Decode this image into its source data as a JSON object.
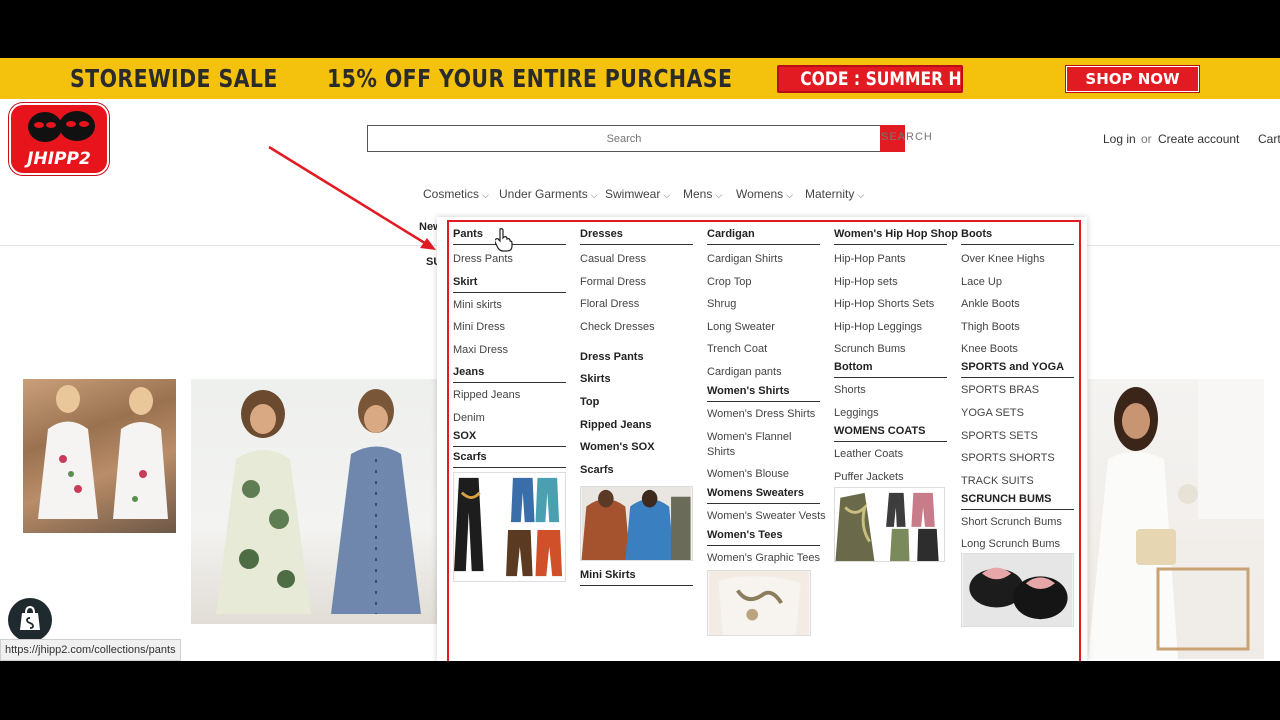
{
  "promo": {
    "sale_text": "STOREWIDE SALE",
    "offer_text": "15% OFF YOUR ENTIRE PURCHASE",
    "code_text": "CODE : SUMMER HEAT",
    "shop_now": "SHOP NOW"
  },
  "brand": {
    "logo_text": "JHIPP2"
  },
  "search": {
    "placeholder": "Search",
    "button_label": "SEARCH"
  },
  "account": {
    "login": "Log in",
    "or": "or",
    "create": "Create account",
    "cart": "Cart"
  },
  "nav": {
    "items": [
      "Cosmetics",
      "Under Garments",
      "Swimwear",
      "Mens",
      "Womens",
      "Maternity"
    ],
    "sub_left_1": "New",
    "sub_left_2": "SU"
  },
  "mega_menu": {
    "col1": {
      "head": "Pants",
      "items": [
        "Dress Pants"
      ],
      "head2": "Skirt",
      "items2": [
        "Mini skirts",
        "Mini Dress",
        "Maxi Dress"
      ],
      "head3": "Jeans",
      "items3": [
        "Ripped Jeans",
        "Denim"
      ],
      "head4": "SOX",
      "head5": "Scarfs"
    },
    "col2": {
      "head": "Dresses",
      "items": [
        "Casual Dress",
        "Formal Dress",
        "Floral Dress",
        "Check Dresses"
      ],
      "bold_items": [
        "Dress Pants",
        "Skirts",
        "Top",
        "Ripped Jeans",
        "Women's SOX",
        "Scarfs"
      ],
      "footer_head": "Mini Skirts"
    },
    "col3": {
      "head": "Cardigan",
      "items": [
        "Cardigan Shirts",
        "Crop Top",
        "Shrug",
        "Long Sweater",
        "Trench Coat",
        "Cardigan pants"
      ],
      "head2": "Women's Shirts",
      "items2": [
        "Women's Dress Shirts",
        "Women's Flannel",
        "Shirts",
        "Women's Blouse"
      ],
      "head3": "Womens Sweaters",
      "items3": [
        "Women's Sweater Vests"
      ],
      "head4": "Women's Tees",
      "items4": [
        "Women's Graphic Tees"
      ]
    },
    "col4": {
      "head": "Women's Hip Hop Shop",
      "items": [
        "Hip-Hop Pants",
        "Hip-Hop sets",
        "Hip-Hop Shorts Sets",
        "Hip-Hop Leggings",
        "Scrunch Bums"
      ],
      "head2": "Bottom",
      "items2": [
        "Shorts",
        "Leggings"
      ],
      "head3": "WOMENS COATS",
      "items3": [
        "Leather Coats",
        "Puffer Jackets"
      ]
    },
    "col5": {
      "head": "Boots",
      "items": [
        "Over Knee Highs",
        "Lace Up",
        "Ankle Boots",
        "Thigh Boots",
        "Knee Boots"
      ],
      "head2": "SPORTS and YOGA",
      "items2": [
        "SPORTS BRAS",
        "YOGA SETS",
        "SPORTS SETS",
        "SPORTS SHORTS",
        "TRACK SUITS"
      ],
      "head3": "SCRUNCH BUMS",
      "items3": [
        "Short Scrunch Bums",
        "Long Scrunch Bums"
      ]
    }
  },
  "status_bar": {
    "url": "https://jhipp2.com/collections/pants"
  },
  "colors": {
    "accent_red": "#e21b23",
    "promo_yellow": "#f4c20d"
  }
}
